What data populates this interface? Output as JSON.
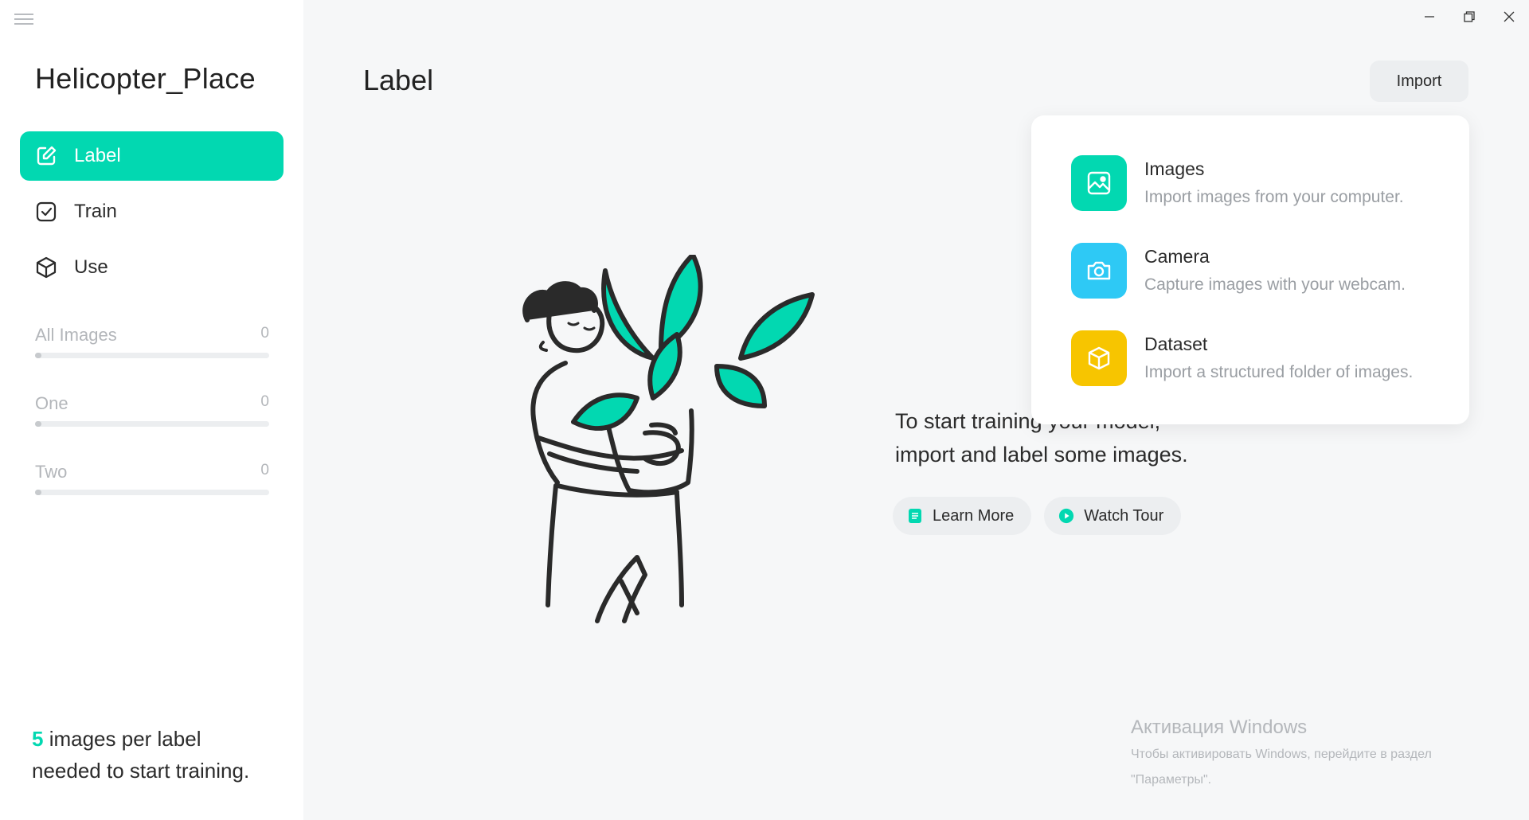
{
  "sidebar": {
    "project_title": "Helicopter_Place",
    "nav": [
      {
        "label": "Label",
        "icon": "edit-icon",
        "active": true
      },
      {
        "label": "Train",
        "icon": "checkbox-icon",
        "active": false
      },
      {
        "label": "Use",
        "icon": "cube-icon",
        "active": false
      }
    ],
    "labels": [
      {
        "name": "All Images",
        "count": "0",
        "progress": 0
      },
      {
        "name": "One",
        "count": "0",
        "progress": 0
      },
      {
        "name": "Two",
        "count": "0",
        "progress": 0
      }
    ],
    "note": {
      "number": "5",
      "text_1": " images per label",
      "text_2": "needed to start training."
    }
  },
  "main": {
    "title": "Label",
    "import_label": "Import",
    "cta_line1": "To start training your model,",
    "cta_line2": "import and label some images.",
    "learn_more": "Learn More",
    "watch_tour": "Watch Tour"
  },
  "import_menu": [
    {
      "title": "Images",
      "subtitle": "Import images from your computer.",
      "icon": "image-icon",
      "color": "#02d8b1"
    },
    {
      "title": "Camera",
      "subtitle": "Capture images with your webcam.",
      "icon": "camera-icon",
      "color": "#2ec9f5"
    },
    {
      "title": "Dataset",
      "subtitle": "Import a structured folder of images.",
      "icon": "box-icon",
      "color": "#f7c500"
    }
  ],
  "watermark": {
    "title": "Активация Windows",
    "line1": "Чтобы активировать Windows, перейдите в раздел",
    "line2": "\"Параметры\"."
  },
  "colors": {
    "accent": "#02d8b1",
    "camera": "#2ec9f5",
    "dataset": "#f7c500"
  }
}
